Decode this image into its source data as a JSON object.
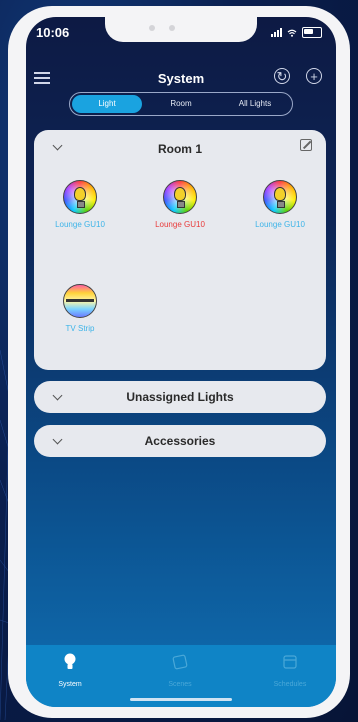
{
  "status": {
    "time": "10:06"
  },
  "header": {
    "title": "System"
  },
  "tabs": [
    {
      "label": "Light",
      "active": true
    },
    {
      "label": "Room",
      "active": false
    },
    {
      "label": "All Lights",
      "active": false
    }
  ],
  "room": {
    "name": "Room 1",
    "lights": [
      {
        "label": "Lounge GU10",
        "color": "#3db4e8",
        "icon": "bulb-icon"
      },
      {
        "label": "Lounge GU10",
        "color": "#e83a3a",
        "icon": "bulb-icon"
      },
      {
        "label": "Lounge GU10",
        "color": "#3db4e8",
        "icon": "bulb-icon"
      },
      {
        "label": "TV Strip",
        "color": "#3db4e8",
        "icon": "light-strip-icon"
      }
    ]
  },
  "sections": {
    "unassigned": "Unassigned Lights",
    "accessories": "Accessories"
  },
  "tabbar": {
    "system": "System",
    "scenes": "Scenes",
    "schedules": "Schedules"
  },
  "colors": {
    "accent": "#1aa3e0",
    "active_tab": "#ffffff",
    "inactive_tab": "#4aa8d8"
  }
}
